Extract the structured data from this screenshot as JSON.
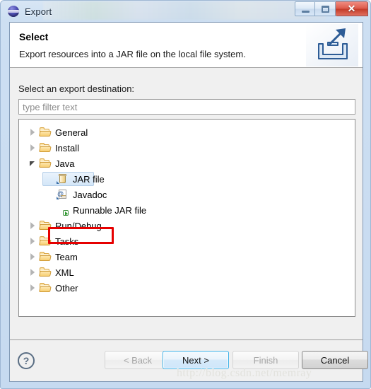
{
  "window": {
    "title": "Export",
    "app_icon": "eclipse-sphere-icon",
    "controls": {
      "minimize_label": "minimize-icon",
      "maximize_label": "maximize-icon",
      "close_label": "✕"
    }
  },
  "header": {
    "title": "Select",
    "description": "Export resources into a JAR file on the local file system.",
    "icon": "export-tray-arrow-icon"
  },
  "content": {
    "destination_label": "Select an export destination:",
    "filter": {
      "value": "",
      "placeholder": "type filter text"
    }
  },
  "tree": [
    {
      "label": "General",
      "depth": 0,
      "icon": "folder-icon",
      "state": "collapsed",
      "selected": false
    },
    {
      "label": "Install",
      "depth": 0,
      "icon": "folder-icon",
      "state": "collapsed",
      "selected": false
    },
    {
      "label": "Java",
      "depth": 0,
      "icon": "folder-icon",
      "state": "expanded",
      "selected": false
    },
    {
      "label": "JAR file",
      "depth": 1,
      "icon": "jar-icon",
      "state": "leaf",
      "selected": true
    },
    {
      "label": "Javadoc",
      "depth": 1,
      "icon": "javadoc-icon",
      "state": "leaf",
      "selected": false
    },
    {
      "label": "Runnable JAR file",
      "depth": 1,
      "icon": "runnable-jar-icon",
      "state": "leaf",
      "selected": false
    },
    {
      "label": "Run/Debug",
      "depth": 0,
      "icon": "folder-icon",
      "state": "collapsed",
      "selected": false
    },
    {
      "label": "Tasks",
      "depth": 0,
      "icon": "folder-icon",
      "state": "collapsed",
      "selected": false
    },
    {
      "label": "Team",
      "depth": 0,
      "icon": "folder-icon",
      "state": "collapsed",
      "selected": false
    },
    {
      "label": "XML",
      "depth": 0,
      "icon": "folder-icon",
      "state": "collapsed",
      "selected": false
    },
    {
      "label": "Other",
      "depth": 0,
      "icon": "folder-icon",
      "state": "collapsed",
      "selected": false
    }
  ],
  "annotation": {
    "color": "#e60000",
    "target": "JAR file"
  },
  "buttons": {
    "help": "?",
    "back": {
      "label": "< Back",
      "enabled": false,
      "default": false
    },
    "next": {
      "label": "Next >",
      "enabled": true,
      "default": true
    },
    "finish": {
      "label": "Finish",
      "enabled": false,
      "default": false
    },
    "cancel": {
      "label": "Cancel",
      "enabled": true,
      "default": false
    }
  },
  "watermark": "http://blog.csdn.net/memray",
  "colors": {
    "accent": "#3cb0e8",
    "annotation": "#e60000",
    "selection": "#d3e6f8",
    "folder": "#f8cf72",
    "dialog_bg": "#f0f0f0"
  }
}
